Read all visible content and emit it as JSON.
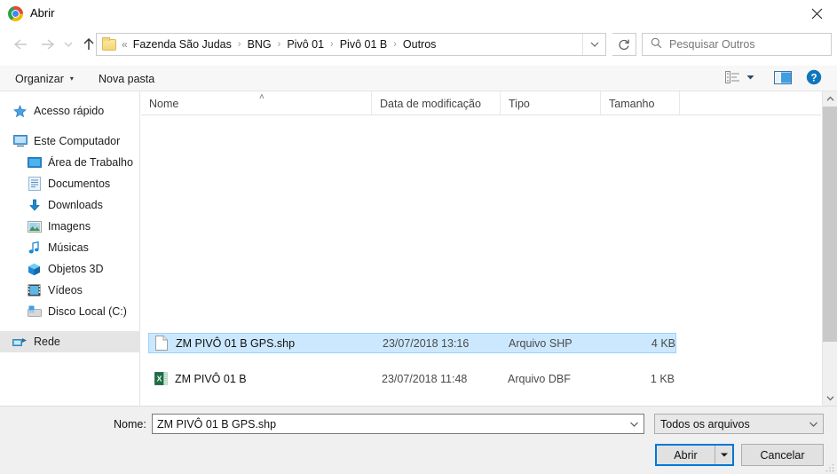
{
  "window": {
    "title": "Abrir",
    "app_icon": "chrome-logo-icon",
    "close_label": "✕"
  },
  "nav": {
    "back_icon": "arrow-left-icon",
    "forward_icon": "arrow-right-icon",
    "recent_icon": "chevron-down-icon",
    "up_icon": "arrow-up-icon",
    "refresh_icon": "refresh-icon",
    "breadcrumb_overflow": "«",
    "breadcrumb": [
      "Fazenda São Judas",
      "BNG",
      "Pivô 01",
      "Pivô 01 B",
      "Outros"
    ],
    "breadcrumb_separator": "›"
  },
  "search": {
    "placeholder": "Pesquisar Outros",
    "value": "",
    "icon": "search-icon"
  },
  "toolbar": {
    "organizar_label": "Organizar",
    "organizar_caret": "▾",
    "nova_pasta_label": "Nova pasta",
    "view_icon": "list-view-icon",
    "view_caret": "▾",
    "preview_pane_icon": "preview-pane-icon",
    "help_icon": "help-icon",
    "help_glyph": "?"
  },
  "sidebar": {
    "items": [
      {
        "label": "Acesso rápido",
        "icon": "star-icon",
        "level": "root",
        "highlighted": false
      },
      {
        "label": "Este Computador",
        "icon": "monitor-icon",
        "level": "root",
        "highlighted": false
      },
      {
        "label": "Área de Trabalho",
        "icon": "desktop-icon",
        "level": "indent",
        "highlighted": false
      },
      {
        "label": "Documentos",
        "icon": "documents-icon",
        "level": "indent",
        "highlighted": false
      },
      {
        "label": "Downloads",
        "icon": "download-arrow-icon",
        "level": "indent",
        "highlighted": false
      },
      {
        "label": "Imagens",
        "icon": "pictures-icon",
        "level": "indent",
        "highlighted": false
      },
      {
        "label": "Músicas",
        "icon": "music-note-icon",
        "level": "indent",
        "highlighted": false
      },
      {
        "label": "Objetos 3D",
        "icon": "cube-3d-icon",
        "level": "indent",
        "highlighted": false
      },
      {
        "label": "Vídeos",
        "icon": "video-film-icon",
        "level": "indent",
        "highlighted": false
      },
      {
        "label": "Disco Local (C:)",
        "icon": "hard-drive-icon",
        "level": "indent",
        "highlighted": false
      },
      {
        "label": "Rede",
        "icon": "network-icon",
        "level": "root",
        "highlighted": true
      }
    ]
  },
  "filelist": {
    "columns": {
      "name": "Nome",
      "modified": "Data de modificação",
      "type": "Tipo",
      "size": "Tamanho"
    },
    "sort_indicator": "˄",
    "rows": [
      {
        "name": "ZM PIVÔ 01 B GPS.shp",
        "modified": "23/07/2018 13:16",
        "type": "Arquivo SHP",
        "size": "4 KB",
        "icon": "generic-file-icon",
        "selected": true
      },
      {
        "name": "ZM PIVÔ 01 B",
        "modified": "23/07/2018 11:48",
        "type": "Arquivo DBF",
        "size": "1 KB",
        "icon": "excel-file-icon",
        "selected": false
      }
    ]
  },
  "bottom": {
    "name_label": "Nome:",
    "name_value": "ZM PIVÔ 01 B GPS.shp",
    "filter_value": "Todos os arquivos",
    "open_label": "Abrir",
    "open_split_caret": "▾",
    "cancel_label": "Cancelar"
  },
  "colors": {
    "selection_fill": "#cce8ff",
    "selection_border": "#99d1ff",
    "focus_blue": "#0078d7",
    "chrome_blue": "#4285f4",
    "excel_green": "#1d7044"
  }
}
